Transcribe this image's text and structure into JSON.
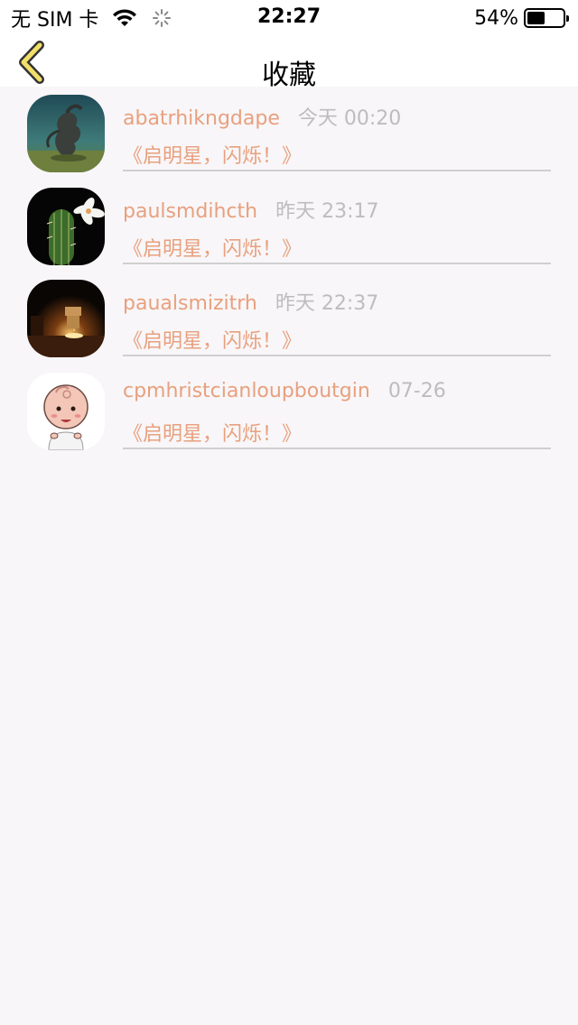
{
  "status_bar": {
    "carrier": "无 SIM 卡",
    "time": "22:27",
    "battery_percent_text": "54%",
    "battery_level": 0.54
  },
  "nav": {
    "title": "收藏",
    "accent": "#f2df6a"
  },
  "favorites": [
    {
      "username": "abatrhikngdape",
      "time": "今天 00:20",
      "title": "《启明星，闪烁！》",
      "avatar": "sculpture"
    },
    {
      "username": "paulsmdihcth",
      "time": "昨天 23:17",
      "title": "《启明星，闪烁！》",
      "avatar": "cactus"
    },
    {
      "username": "paualsmizitrh",
      "time": "昨天 22:37",
      "title": "《启明星，闪烁！》",
      "avatar": "candle"
    },
    {
      "username": "cpmhristcianloupboutgin",
      "time": "07-26",
      "title": "《启明星，闪烁！》",
      "avatar": "baby-cartoon"
    }
  ],
  "colors": {
    "username": "#e8a07e",
    "time": "#bdbdbd",
    "background": "#f8f6f8"
  }
}
